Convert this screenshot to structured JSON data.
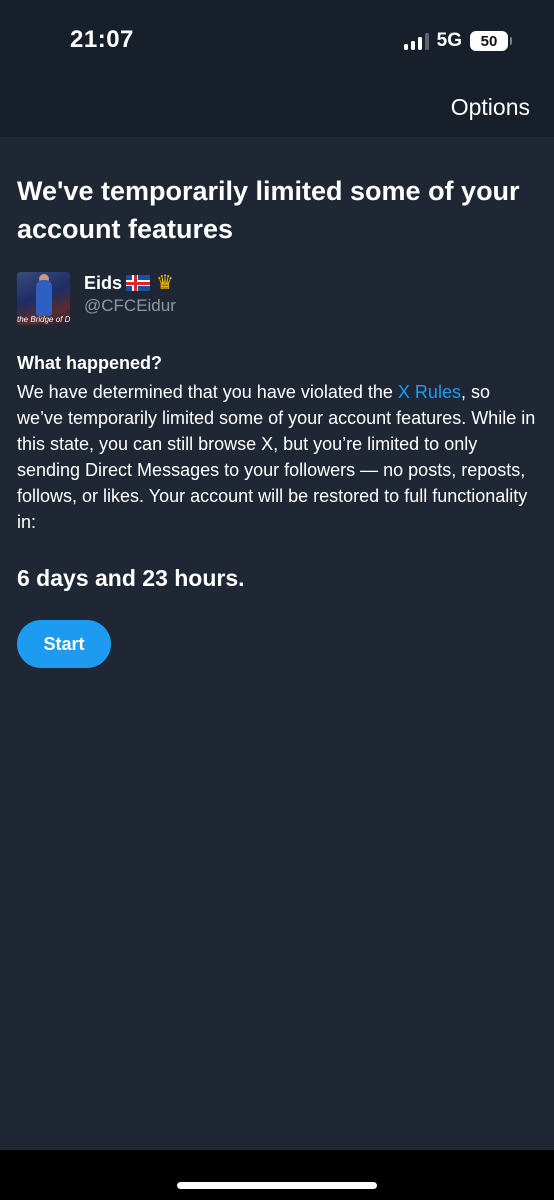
{
  "status_bar": {
    "time": "21:07",
    "network": "5G",
    "battery": "50",
    "signal_bars_filled": 3,
    "signal_bars_total": 4
  },
  "nav": {
    "options_label": "Options"
  },
  "main": {
    "title": "We've temporarily limited some of your account features",
    "account": {
      "display_name": "Eids",
      "handle": "@CFCEidur",
      "avatar_caption": "the Bridge of D"
    },
    "section_title": "What happened?",
    "body_before_link": "We have determined that you have violated the ",
    "link_text": "X Rules",
    "body_after_link": ", so we’ve temporarily limited some of your account features. While in this state, you can still browse X, but you’re limited to only sending Direct Messages to your followers — no posts, reposts, follows, or likes. Your account will be restored to full functionality in:",
    "countdown": "6 days and 23 hours.",
    "start_label": "Start"
  },
  "icons": {
    "flag": "iceland-flag-icon",
    "crown": "crown-icon"
  },
  "colors": {
    "background": "#1e2733",
    "header": "#17202a",
    "accent": "#1d9bf0",
    "secondary_text": "#8b98a5"
  }
}
